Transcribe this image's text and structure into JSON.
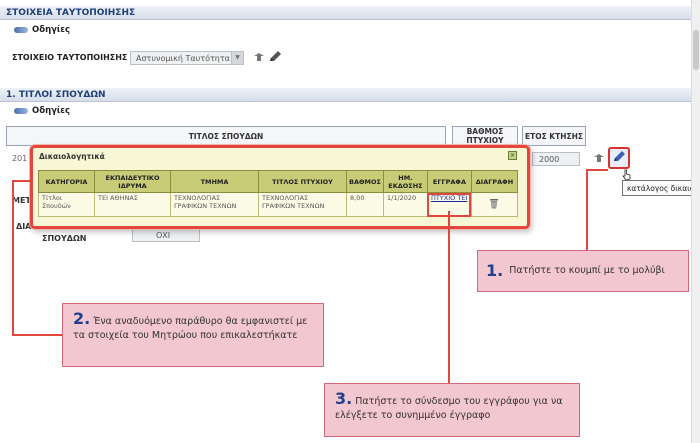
{
  "identification": {
    "section_title": "ΣΤΟΙΧΕΙΑ ΤΑΥΤΟΠΟΙΗΣΗΣ",
    "guide": "Οδηγίες",
    "field_label": "ΣΤΟΙΧΕΙΟ ΤΑΥΤΟΠΟΙΗΣΗΣ",
    "field_value": "Αστυνομική Ταυτότητα"
  },
  "studies": {
    "section_title": "1. ΤΙΤΛΟΙ ΣΠΟΥΔΩΝ",
    "guide": "Οδηγίες",
    "headers": {
      "title": "ΤΙΤΛΟΣ ΣΠΟΥΔΩΝ",
      "grade": "ΒΑΘΜΟΣ ΠΤΥΧΙΟΥ",
      "year": "ΕΤΟΣ ΚΤΗΣΗΣ"
    },
    "row_prefix": "201",
    "year_value": "2000",
    "met_label": "ΜΕΤ",
    "dia_label": "ΔΙΑ",
    "studies_label": "ΣΠΟΥΔΩΝ",
    "no_value": "ΟΧΙ",
    "edit_tooltip": "κατάλογος δικαιολογητικών"
  },
  "popup": {
    "title": "Δικαιολογητικά",
    "close_symbol": "×",
    "columns": [
      "ΚΑΤΗΓΟΡΙΑ",
      "ΕΚΠΑΙΔΕΥΤΙΚΟ ΙΔΡΥΜΑ",
      "ΤΜΗΜΑ",
      "ΤΙΤΛΟΣ ΠΤΥΧΙΟΥ",
      "ΒΑΘΜΟΣ",
      "ΗΜ. ΕΚΔΟΣΗΣ",
      "ΕΓΓΡΑΦΑ",
      "ΔΙΑΓΡΑΦΗ"
    ],
    "row": {
      "category": "Τίτλοι Σπουδών",
      "institution": "ΤΕΙ ΑΘΗΝΑΣ",
      "department": "ΤΕΧΝΟΛΟΓΙΑΣ ΓΡΑΦΙΚΩΝ ΤΕΧΝΩΝ",
      "degree_title": "ΤΕΧΝΟΛΟΓΙΑΣ ΓΡΑΦΙΚΩΝ ΤΕΧΝΩΝ",
      "grade": "8,00",
      "issue_date": "1/1/2020",
      "document": "ΠΤΥΧΙΟ ΤΕΙ"
    }
  },
  "callouts": {
    "c1": {
      "num": "1.",
      "text": "Πατήστε το κουμπί με το μολύβι"
    },
    "c2": {
      "num": "2.",
      "text": "Ένα αναδυόμενο παράθυρο θα εμφανιστεί με τα στοιχεία του Μητρώου που επικαλεστήκατε"
    },
    "c3": {
      "num": "3.",
      "text": "Πατήστε το σύνδεσμο του εγγράφου για να ελέγξετε το συνημμένο έγγραφο"
    }
  },
  "colors": {
    "highlight": "#e2473e",
    "callout_bg": "#f2c7cf",
    "popup_bg": "#f7f7d5",
    "header_text": "#1f3f7a"
  }
}
